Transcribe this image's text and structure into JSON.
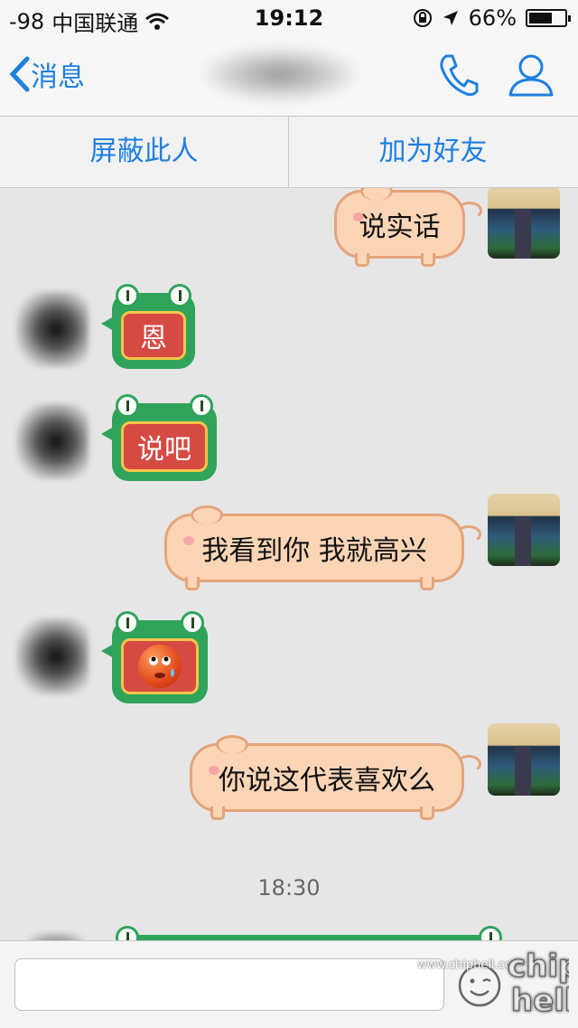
{
  "status": {
    "signal": "-98",
    "carrier": "中国联通",
    "time": "19:12",
    "battery": "66%",
    "battery_fraction": 0.66
  },
  "nav": {
    "back_label": "消息"
  },
  "actions": {
    "block_label": "屏蔽此人",
    "add_friend_label": "加为好友"
  },
  "messages": [
    {
      "from": "me",
      "text": "说实话"
    },
    {
      "from": "other",
      "text": "恩"
    },
    {
      "from": "other",
      "text": "说吧"
    },
    {
      "from": "me",
      "text": "我看到你 我就高兴"
    },
    {
      "from": "other",
      "emoji": "sweat-face"
    },
    {
      "from": "me",
      "text": "你说这代表喜欢么"
    }
  ],
  "timestamp": "18:30",
  "input": {
    "value": "",
    "placeholder": ""
  },
  "watermark": {
    "url": "www.chiphell.com",
    "logo": "chip hell"
  },
  "colors": {
    "accent": "#1e7fe0",
    "pig_bubble": "#fbd5b6",
    "frog_bubble": "#2fa35a",
    "frog_inner": "#d64a44"
  }
}
